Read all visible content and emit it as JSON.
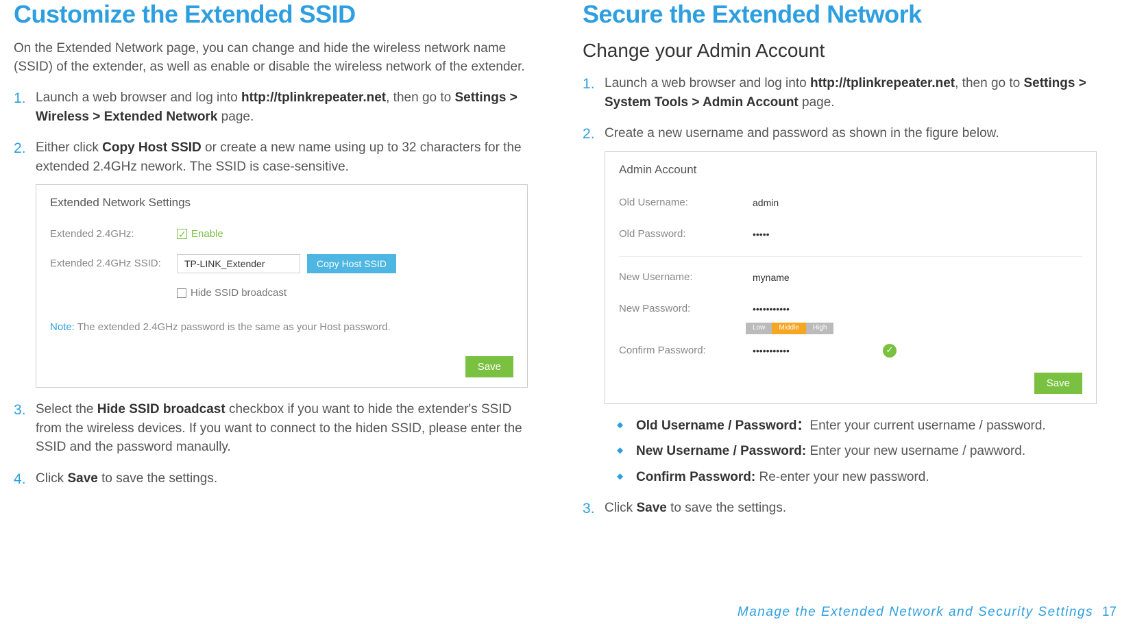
{
  "left": {
    "title": "Customize the Extended SSID",
    "intro": "On the Extended Network page, you can change and hide the wireless network name (SSID) of the extender, as well as enable or disable the wireless network of the extender.",
    "step1_a": "Launch a web browser and log into ",
    "step1_url": "http://tplinkrepeater.net",
    "step1_b": ", then go to ",
    "step1_path": "Settings > Wireless > Extended Network",
    "step1_c": " page.",
    "step2_a": "Either click ",
    "step2_b": "Copy Host SSID",
    "step2_c": " or create a new name using up to 32 characters for the extended 2.4GHz nework. The SSID is case-sensitive.",
    "step3_a": "Select the ",
    "step3_b": "Hide SSID broadcast",
    "step3_c": " checkbox if you want to hide the extender's SSID from the wireless devices. If you want to connect to the hiden SSID, please enter the SSID and the password manaully.",
    "step4_a": "Click ",
    "step4_b": "Save",
    "step4_c": " to save the settings.",
    "shot": {
      "title": "Extended Network Settings",
      "row1_label": "Extended 2.4GHz:",
      "enable": "Enable",
      "row2_label": "Extended 2.4GHz SSID:",
      "ssid_value": "TP-LINK_Extender",
      "copy_btn": "Copy Host SSID",
      "hide_label": "Hide SSID broadcast",
      "note_label": "Note:",
      "note_text": "The extended 2.4GHz password is the same as your Host password.",
      "save": "Save"
    }
  },
  "right": {
    "title": "Secure the Extended Network",
    "subtitle": "Change your Admin Account",
    "step1_a": "Launch a web browser and log into ",
    "step1_url": "http://tplinkrepeater.net",
    "step1_b": ", then go to ",
    "step1_path": "Settings > System Tools > Admin Account",
    "step1_c": " page.",
    "step2": "Create a new username and password as shown in the figure below.",
    "shot": {
      "title": "Admin Account",
      "old_user_label": "Old Username:",
      "old_user_value": "admin",
      "old_pass_label": "Old Password:",
      "old_pass_value": "•••••",
      "new_user_label": "New Username:",
      "new_user_value": "myname",
      "new_pass_label": "New Password:",
      "new_pass_value": "•••••••••••",
      "strength_low": "Low",
      "strength_mid": "Middle",
      "strength_high": "High",
      "confirm_label": "Confirm Password:",
      "confirm_value": "•••••••••••",
      "save": "Save"
    },
    "bullet1_b": "Old Username / Password：",
    "bullet1_t": "Enter your current username / password.",
    "bullet2_b": "New Username / Password: ",
    "bullet2_t": "Enter your new username / pawword.",
    "bullet3_b": "Confirm Password: ",
    "bullet3_t": "Re-enter your new password.",
    "step3_a": "Click ",
    "step3_b": "Save",
    "step3_c": " to save the settings."
  },
  "footer": {
    "text": "Manage  the  Extended  Network  and  Security  Settings",
    "page": "17"
  }
}
